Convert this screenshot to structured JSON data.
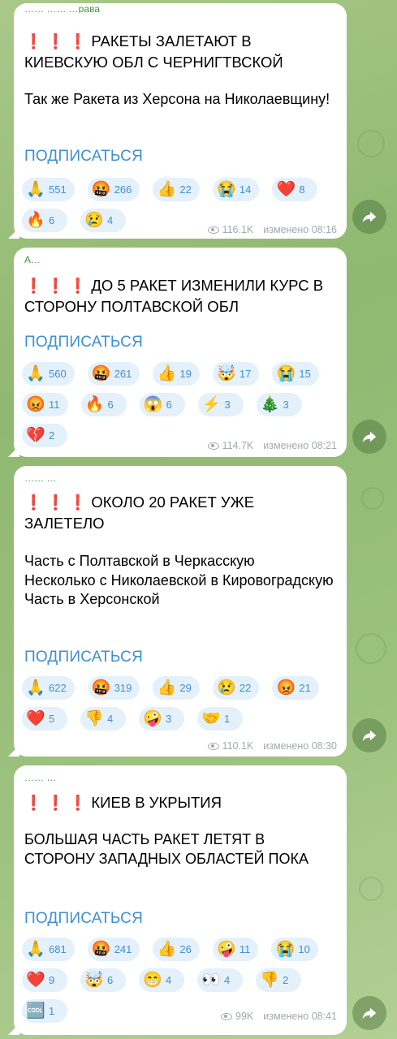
{
  "subscribe_label": "ПОДПИСАТЬСЯ",
  "posts": [
    {
      "channel": "…… …… …рава",
      "marks": "❗ ❗ ❗",
      "title": "РАКЕТЫ ЗАЛЕТАЮТ В КИЕВСКУЮ ОБЛ С ЧЕРНИГТВСКОЙ",
      "body": "Так же Ракета из Херсона на Николаевщину!",
      "reactions": [
        {
          "icon": "🙏",
          "count": "551"
        },
        {
          "icon": "🤬",
          "count": "266"
        },
        {
          "icon": "👍",
          "count": "22"
        },
        {
          "icon": "😭",
          "count": "14"
        },
        {
          "icon": "❤️",
          "count": "8"
        },
        {
          "icon": "🔥",
          "count": "6"
        },
        {
          "icon": "😢",
          "count": "4"
        }
      ],
      "views": "116.1K",
      "edited": "изменено 08:16"
    },
    {
      "channel": "А…",
      "marks": "❗ ❗ ❗",
      "title": "ДО 5 РАКЕТ ИЗМЕНИЛИ КУРС В СТОРОНУ ПОЛТАВСКОЙ ОБЛ",
      "body": "",
      "reactions": [
        {
          "icon": "🙏",
          "count": "560"
        },
        {
          "icon": "🤬",
          "count": "261"
        },
        {
          "icon": "👍",
          "count": "19"
        },
        {
          "icon": "🤯",
          "count": "17"
        },
        {
          "icon": "😭",
          "count": "15"
        },
        {
          "icon": "😡",
          "count": "11"
        },
        {
          "icon": "🔥",
          "count": "6"
        },
        {
          "icon": "😱",
          "count": "6"
        },
        {
          "icon": "⚡",
          "count": "3"
        },
        {
          "icon": "🎄",
          "count": "3"
        },
        {
          "icon": "💔",
          "count": "2"
        }
      ],
      "views": "114.7K",
      "edited": "изменено 08:21"
    },
    {
      "channel": "…… …",
      "marks": "❗ ❗ ❗",
      "title": "ОКОЛО 20 РАКЕТ УЖЕ ЗАЛЕТЕЛО",
      "body": "Часть с Полтавской в Черкасскую\nНесколько с Николаевской в Кировоградскую\nЧасть в Херсонской",
      "reactions": [
        {
          "icon": "🙏",
          "count": "622"
        },
        {
          "icon": "🤬",
          "count": "319"
        },
        {
          "icon": "👍",
          "count": "29"
        },
        {
          "icon": "😢",
          "count": "22"
        },
        {
          "icon": "😡",
          "count": "21"
        },
        {
          "icon": "❤️",
          "count": "5"
        },
        {
          "icon": "👎",
          "count": "4"
        },
        {
          "icon": "🤪",
          "count": "3"
        },
        {
          "icon": "🤝",
          "count": "1"
        }
      ],
      "views": "110.1K",
      "edited": "изменено 08:30"
    },
    {
      "channel": "…… …",
      "marks": "❗ ❗ ❗",
      "title": "КИЕВ В УКРЫТИЯ",
      "body": "БОЛЬШАЯ ЧАСТЬ РАКЕТ ЛЕТЯТ В СТОРОНУ ЗАПАДНЫХ ОБЛАСТЕЙ ПОКА",
      "reactions": [
        {
          "icon": "🙏",
          "count": "681"
        },
        {
          "icon": "🤬",
          "count": "241"
        },
        {
          "icon": "👍",
          "count": "26"
        },
        {
          "icon": "🤪",
          "count": "11"
        },
        {
          "icon": "😭",
          "count": "10"
        },
        {
          "icon": "❤️",
          "count": "9"
        },
        {
          "icon": "🤯",
          "count": "6"
        },
        {
          "icon": "😁",
          "count": "4"
        },
        {
          "icon": "👀",
          "count": "4"
        },
        {
          "icon": "👎",
          "count": "2"
        },
        {
          "icon": "🆒",
          "count": "1"
        }
      ],
      "views": "99K",
      "edited": "изменено 08:41"
    }
  ]
}
